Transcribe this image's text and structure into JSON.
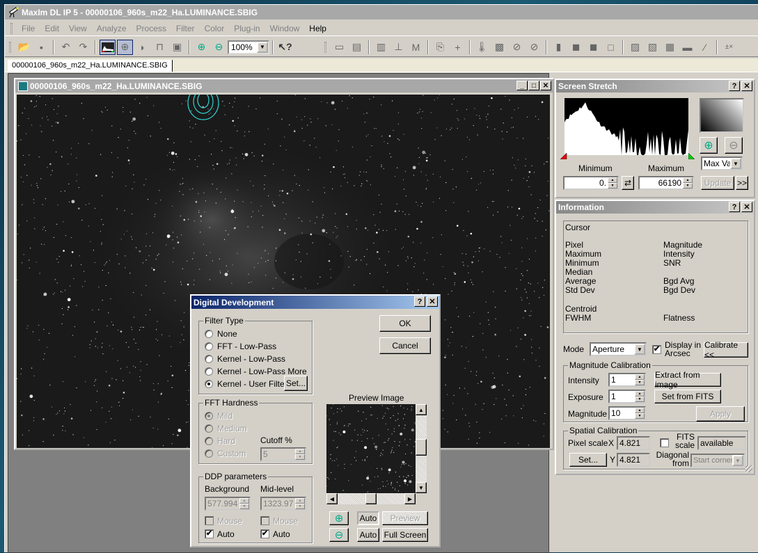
{
  "app": {
    "title": "MaxIm DL IP 5 - 00000106_960s_m22_Ha.LUMINANCE.SBIG",
    "menu": [
      "File",
      "Edit",
      "View",
      "Analyze",
      "Process",
      "Filter",
      "Color",
      "Plug-in",
      "Window",
      "Help"
    ],
    "zoom_value": "100%",
    "tab": "00000106_960s_m22_Ha.LUMINANCE.SBIG"
  },
  "toolbar_icons": [
    "open-icon",
    "save-icon",
    "undo-icon",
    "redo-icon",
    "screen-stretch-icon",
    "information-icon",
    "blink-icon",
    "lock-icon",
    "properties-icon",
    "zoom-in-icon",
    "zoom-out-icon",
    "context-help-icon",
    "histogram-icon",
    "stack-icon",
    "combine-icon",
    "align-icon",
    "median-icon",
    "copy-icon",
    "add-icon",
    "thermometer-icon",
    "kernel-filter-icon",
    "no-filter-icon",
    "no-bloom-icon",
    "bar-chart-icon",
    "overlap-icon",
    "overlap-2-icon",
    "crop-icon",
    "flat-1-icon",
    "flat-2-icon",
    "flat-3-icon",
    "bin-icon",
    "curve-icon",
    "math-ops-icon"
  ],
  "image_window": {
    "title": "00000106_960s_m22_Ha.LUMINANCE.SBIG"
  },
  "screen_stretch": {
    "title": "Screen Stretch",
    "minimum_label": "Minimum",
    "maximum_label": "Maximum",
    "minimum_value": "0.",
    "maximum_value": "66190",
    "mode": "Max Val",
    "update": "Update",
    "more": ">>"
  },
  "information": {
    "title": "Information",
    "cursor": "Cursor",
    "left_labels": [
      "Pixel",
      "Maximum",
      "Minimum",
      "Median",
      "Average",
      "Std Dev"
    ],
    "right_labels": [
      "Magnitude",
      "Intensity",
      "SNR",
      "",
      "Bgd Avg",
      "Bgd Dev"
    ],
    "centroid": "Centroid",
    "fwhm": "FWHM",
    "flatness": "Flatness",
    "mode_label": "Mode",
    "mode_value": "Aperture",
    "display_arcsec": "Display in Arcsec",
    "display_arcsec_checked": true,
    "calibrate": "Calibrate <<",
    "mag_cal": {
      "title": "Magnitude Calibration",
      "intensity_label": "Intensity",
      "intensity": "1",
      "exposure_label": "Exposure",
      "exposure": "1",
      "magnitude_label": "Magnitude",
      "magnitude": "10",
      "extract": "Extract from image",
      "set_fits": "Set from FITS",
      "apply": "Apply"
    },
    "spatial_cal": {
      "title": "Spatial Calibration",
      "pixel_scale": "Pixel scale",
      "x_label": "X",
      "x": "4.821",
      "y_label": "Y",
      "y": "4.821",
      "set": "Set...",
      "fits_scale": "FITS scale",
      "fits_value": "available",
      "diagonal_from": "Diagonal from",
      "start_corner": "Start corner"
    }
  },
  "digital_development": {
    "title": "Digital Development",
    "ok": "OK",
    "cancel": "Cancel",
    "filter_type": "Filter Type",
    "filters": [
      "None",
      "FFT - Low-Pass",
      "Kernel - Low-Pass",
      "Kernel - Low-Pass More",
      "Kernel - User Filter"
    ],
    "selected_filter": 4,
    "set": "Set...",
    "fft_hardness": "FFT Hardness",
    "hardness": [
      "Mild",
      "Medium",
      "Hard",
      "Custom"
    ],
    "cutoff_label": "Cutoff %",
    "cutoff": "5",
    "ddp": "DDP parameters",
    "background_label": "Background",
    "background": "577.994",
    "midlevel_label": "Mid-level",
    "midlevel": "1323.97",
    "mouse": "Mouse",
    "auto": "Auto",
    "preview_label": "Preview Image",
    "preview_auto": "Auto",
    "preview_btn": "Preview",
    "auto2": "Auto",
    "full_screen": "Full Screen"
  }
}
